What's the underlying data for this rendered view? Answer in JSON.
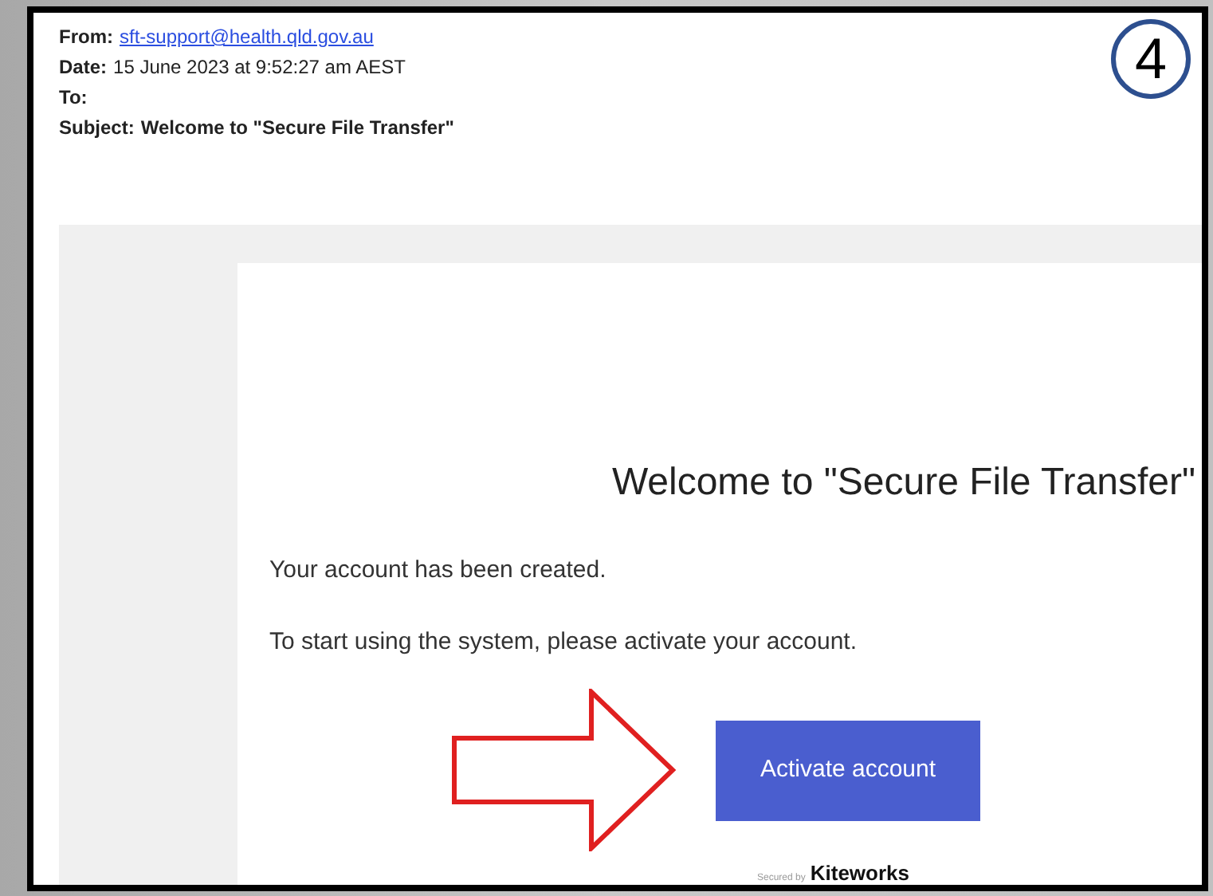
{
  "header": {
    "from_label": "From:",
    "from": "sft-support@health.qld.gov.au",
    "date_label": "Date:",
    "date": "15 June 2023 at 9:52:27 am AEST",
    "to_label": "To:",
    "subject_label": "Subject:",
    "subject": "Welcome to \"Secure File Transfer\""
  },
  "step_badge": "4",
  "email": {
    "title": "Welcome to \"Secure File Transfer\"",
    "paragraphs": [
      "Your account has been created.",
      "To start using the system, please activate your account."
    ],
    "button": "Activate account",
    "footer_small": "Secured by",
    "footer_brand": "Kiteworks"
  }
}
